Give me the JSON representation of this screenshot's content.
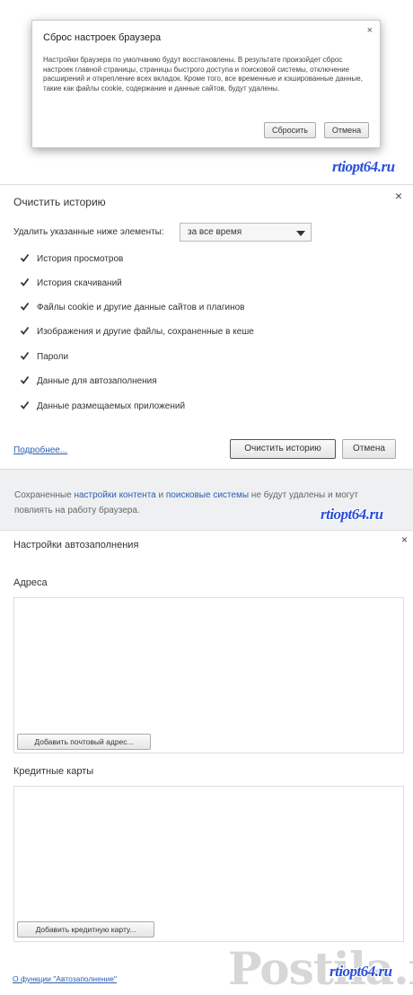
{
  "reset_dialog": {
    "title": "Сброс настроек браузера",
    "close": "×",
    "text": "Настройки браузера по умолчанию будут восстановлены. В результате произойдет сброс настроек главной страницы, страницы быстрого доступа и поисковой системы, отключение расширений и открепление всех вкладок. Кроме того, все временные и кэшированные данные, такие как файлы cookie, содержание и данные сайтов, будут удалены.",
    "reset_label": "Сбросить",
    "cancel_label": "Отмена"
  },
  "watermark": "rtiopt64.ru",
  "clear_history": {
    "title": "Очистить историю",
    "close": "×",
    "delete_label": "Удалить указанные ниже элементы:",
    "time_range": "за все время",
    "items": [
      {
        "label": "История просмотров",
        "checked": true
      },
      {
        "label": "История скачиваний",
        "checked": true
      },
      {
        "label": "Файлы cookie и другие данные сайтов и плагинов",
        "checked": true
      },
      {
        "label": "Изображения и другие файлы, сохраненные в кеше",
        "checked": true
      },
      {
        "label": "Пароли",
        "checked": true
      },
      {
        "label": "Данные для автозаполнения",
        "checked": true
      },
      {
        "label": "Данные размещаемых приложений",
        "checked": true
      }
    ],
    "more_link": "Подробнее...",
    "clear_label": "Очистить историю",
    "cancel_label": "Отмена",
    "footer": {
      "part1": "Сохраненные ",
      "link1": "настройки контента",
      "part2": " и ",
      "link2": "поисковые системы",
      "part3": " не будут удалены и могут повлиять на работу браузера."
    }
  },
  "autofill": {
    "title": "Настройки автозаполнения",
    "close": "×",
    "addresses_label": "Адреса",
    "add_address_label": "Добавить почтовый адрес...",
    "cards_label": "Кредитные карты",
    "add_card_label": "Добавить кредитную карту...",
    "about_link": "О функции \"Автозаполнение\""
  },
  "logo_text": "Postila.ru"
}
